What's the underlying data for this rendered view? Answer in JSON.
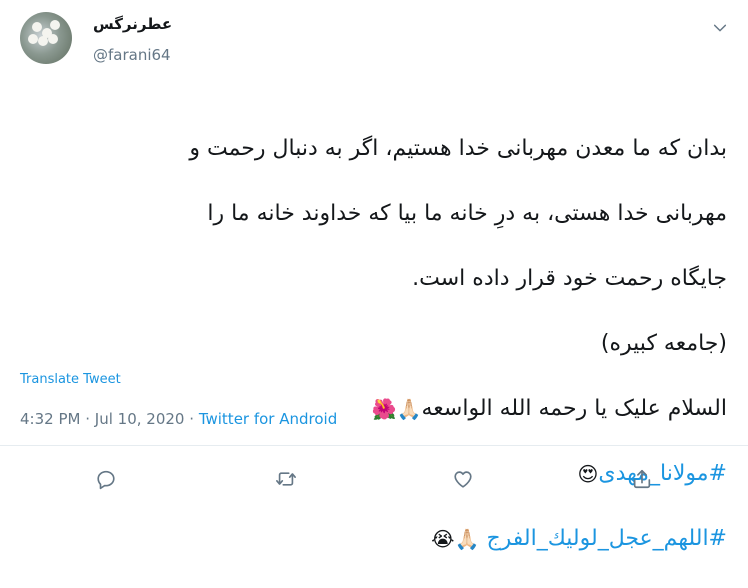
{
  "tweet": {
    "display_name": "عطرنرگس",
    "handle": "@farani64",
    "lines": [
      "بدان که ما معدن مهربانی خدا هستیم، اگر به دنبال رحمت و",
      "مهربانی خدا هستی، به درِ خانه ما بیا که خداوند خانه ما را",
      "جایگاه رحمت خود قرار داده است.",
      "(جامعه کبیره)",
      "السلام علیک یا رحمه الله الواسعه",
      "#مولانا_مهدی",
      "#اللهم_عجل_لولیك_الفرج"
    ],
    "emojis": {
      "prayer": "🙏🏻",
      "hibiscus": "🌺",
      "heart_eyes": "😍",
      "crying": "😭"
    },
    "translate_label": "Translate Tweet",
    "time": "4:32 PM",
    "separator": "·",
    "date": "Jul 10, 2020",
    "source": "Twitter for Android"
  },
  "colors": {
    "link": "#1b95e0",
    "secondary_text": "#657786",
    "divider": "#e6ecf0"
  },
  "actions": [
    "reply-icon",
    "retweet-icon",
    "like-icon",
    "share-icon"
  ]
}
